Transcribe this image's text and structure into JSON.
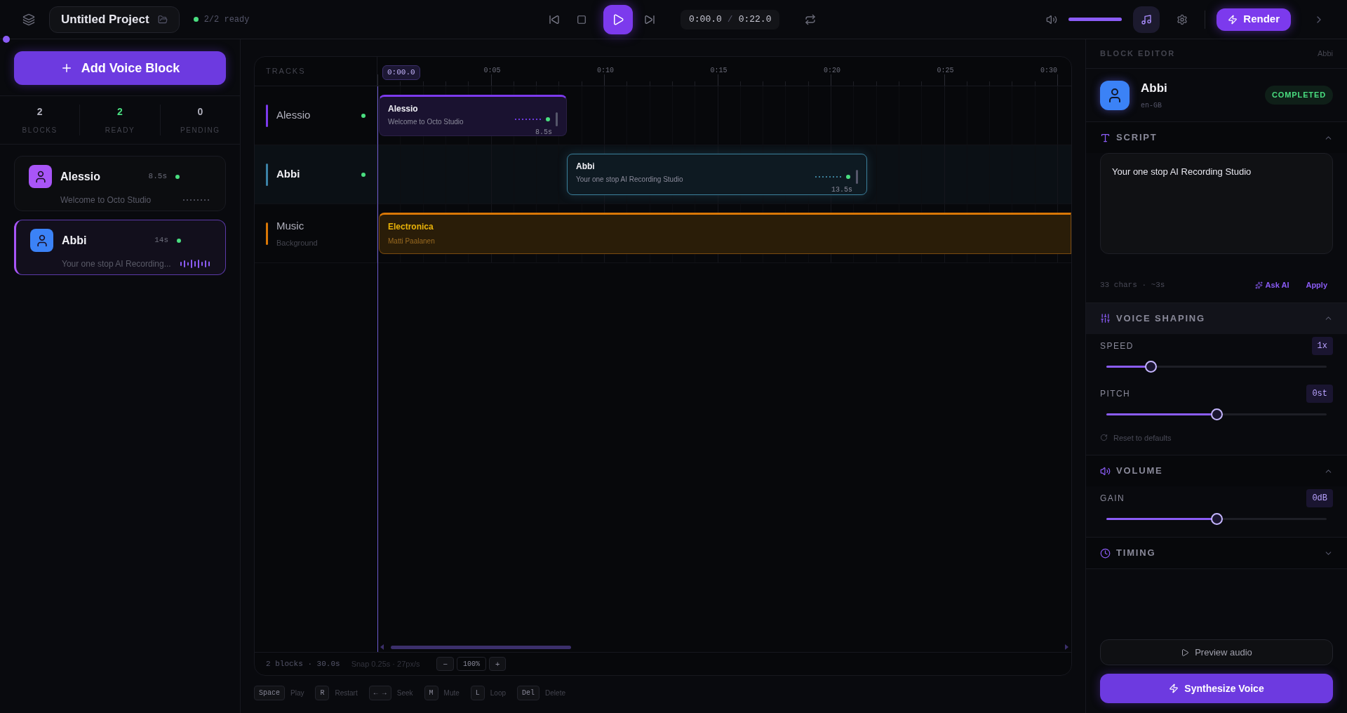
{
  "toolbar": {
    "project_title": "Untitled Project",
    "status": "2/2 ready",
    "current_time": "0:00.0",
    "separator": "/",
    "total_time": "0:22.0",
    "playing": false,
    "volume": {
      "level": 1
    },
    "music": {
      "selected": true
    },
    "render": "Render"
  },
  "sidebar": {
    "add_button": "Add Voice Block",
    "stats": [
      {
        "value": "2",
        "label": "BLOCKS",
        "kind": "neutral"
      },
      {
        "value": "2",
        "label": "READY",
        "kind": "ready"
      },
      {
        "value": "0",
        "label": "PENDING",
        "kind": "neutral"
      }
    ],
    "blocks": [
      {
        "name": "Alessio",
        "duration": "8.5s",
        "text": "Welcome to Octo Studio",
        "ready": true,
        "selected": false,
        "color": "#a855f7"
      },
      {
        "name": "Abbi",
        "duration": "14s",
        "text": "Your one stop AI Recording...",
        "ready": true,
        "selected": true,
        "color": "#3b82f6"
      }
    ]
  },
  "timeline": {
    "header": "TRACKS",
    "playhead": "0:00.0",
    "ticks": [
      "0:05",
      "0:10",
      "0:15",
      "0:20",
      "0:25",
      "0:30"
    ],
    "tracks": [
      {
        "kind": "voice",
        "name": "Alessio",
        "color": "#7c3aed",
        "ready": true,
        "selected": false,
        "clip": {
          "title": "Alessio",
          "text": "Welcome to Octo Studio",
          "duration": "8.5s"
        }
      },
      {
        "kind": "voice",
        "name": "Abbi",
        "color": "#3b82a6",
        "ready": true,
        "selected": true,
        "clip": {
          "title": "Abbi",
          "text": "Your one stop AI Recording Studio",
          "duration": "13.5s"
        }
      },
      {
        "kind": "music",
        "name": "Music",
        "subtitle": "Background",
        "color": "#d97706",
        "selected": false,
        "clip": {
          "title": "Electronica",
          "text": "Matti Paalanen"
        }
      }
    ],
    "footer": {
      "summary": "2 blocks · 30.0s",
      "snap": "Snap 0.25s · 27px/s",
      "zoom_out": "−",
      "zoom": "100%",
      "zoom_in": "+"
    }
  },
  "shortcuts": [
    {
      "key": "Space",
      "label": "Play"
    },
    {
      "key": "R",
      "label": "Restart"
    },
    {
      "key": "← →",
      "label": "Seek"
    },
    {
      "key": "M",
      "label": "Mute"
    },
    {
      "key": "L",
      "label": "Loop"
    },
    {
      "key": "Del",
      "label": "Delete"
    }
  ],
  "editor": {
    "title": "BLOCK EDITOR",
    "block_name": "Abbi",
    "voice": "Abbi",
    "locale": "en-GB",
    "status": "COMPLETED",
    "sections": [
      {
        "kind": "script",
        "title": "SCRIPT",
        "expanded": true,
        "text": "Your one stop AI Recording Studio",
        "meta": "33 chars · ~3s",
        "ask_ai": "Ask AI",
        "apply": "Apply"
      },
      {
        "kind": "shaping",
        "title": "VOICE SHAPING",
        "expanded": true,
        "highlighted": true,
        "sliders": [
          {
            "label": "SPEED",
            "value": "1x",
            "level": 0.2
          },
          {
            "label": "PITCH",
            "value": "0st",
            "level": 0.5
          }
        ],
        "reset": "Reset to defaults"
      },
      {
        "kind": "volume",
        "title": "VOLUME",
        "expanded": true,
        "highlighted": false,
        "sliders": [
          {
            "label": "GAIN",
            "value": "0dB",
            "level": 0.5
          }
        ]
      },
      {
        "kind": "timing",
        "title": "TIMING",
        "expanded": false,
        "highlighted": false
      }
    ],
    "preview": "Preview audio",
    "synthesize": "Synthesize Voice"
  }
}
